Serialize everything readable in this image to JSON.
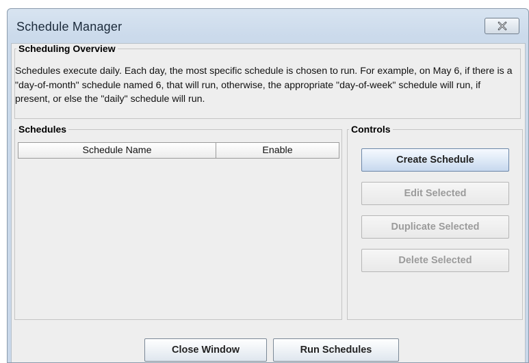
{
  "window": {
    "title": "Schedule Manager"
  },
  "overview": {
    "legend": "Scheduling Overview",
    "text": "Schedules execute daily. Each day, the most specific schedule is chosen to run. For example, on May 6, if there is a \"day-of-month\" schedule named 6, that will run, otherwise, the appropriate \"day-of-week\" schedule will run, if present, or else the \"daily\" schedule will run."
  },
  "schedules": {
    "legend": "Schedules",
    "columns": [
      "Schedule Name",
      "Enable"
    ],
    "rows": []
  },
  "controls": {
    "legend": "Controls",
    "create_label": "Create Schedule",
    "edit_label": "Edit Selected",
    "duplicate_label": "Duplicate Selected",
    "delete_label": "Delete Selected"
  },
  "footer": {
    "close_label": "Close Window",
    "run_label": "Run Schedules"
  },
  "icons": {
    "close": "close-icon"
  }
}
